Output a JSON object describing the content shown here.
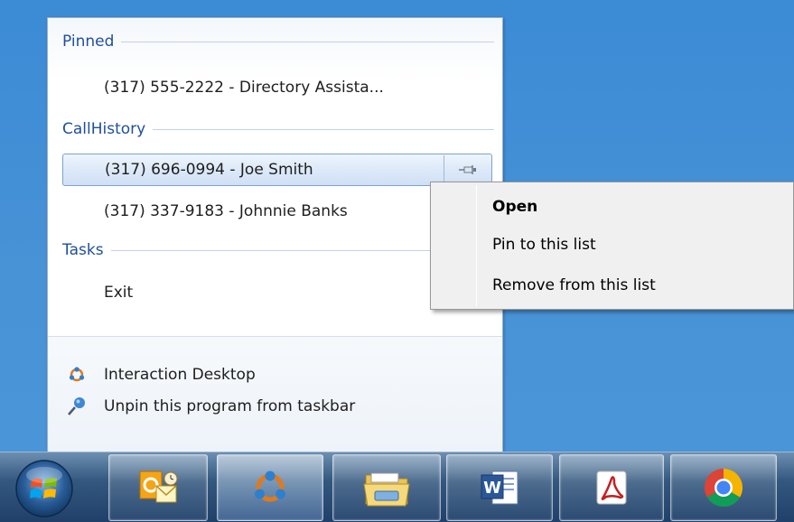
{
  "jumplist": {
    "pinned": {
      "header": "Pinned",
      "items": [
        {
          "label": "(317) 555-2222 - Directory Assista..."
        }
      ]
    },
    "call_history": {
      "header": "CallHistory",
      "items": [
        {
          "label": "(317) 696-0994 - Joe Smith"
        },
        {
          "label": "(317) 337-9183 - Johnnie Banks"
        }
      ]
    },
    "tasks": {
      "header": "Tasks",
      "items": [
        {
          "label": "Exit"
        }
      ]
    },
    "footer": {
      "app_label": "Interaction  Desktop",
      "unpin_label": "Unpin this program from taskbar"
    }
  },
  "context_menu": {
    "items": [
      {
        "label": "Open"
      },
      {
        "label": "Pin to this list"
      },
      {
        "label": "Remove from this list"
      }
    ]
  },
  "taskbar": {
    "start_icon": "windows-start-orb",
    "apps": [
      {
        "icon": "outlook-icon"
      },
      {
        "icon": "interaction-desktop-icon"
      },
      {
        "icon": "file-explorer-icon"
      },
      {
        "icon": "word-icon"
      },
      {
        "icon": "acrobat-icon"
      },
      {
        "icon": "chrome-icon"
      }
    ]
  },
  "colors": {
    "desktop": "#4a90d0",
    "header_text": "#1f4f9c",
    "taskbar": "#2a4b74"
  }
}
